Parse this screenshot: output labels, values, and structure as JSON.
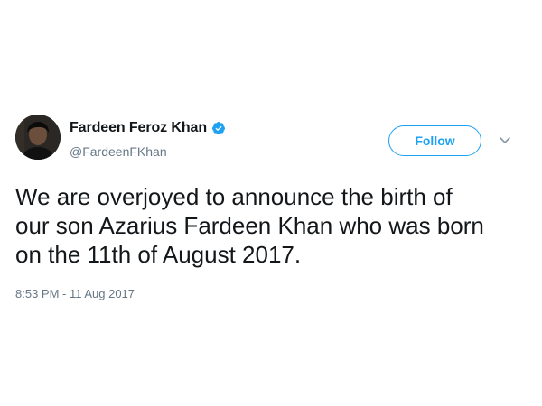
{
  "author": {
    "display_name": "Fardeen Feroz Khan",
    "handle": "@FardeenFKhan",
    "verified": true,
    "avatar_icon": "avatar-photo"
  },
  "actions": {
    "follow_label": "Follow",
    "menu_icon": "chevron-down-icon"
  },
  "tweet": {
    "lines": [
      "We are overjoyed to announce the birth of",
      "our son Azarius Fardeen Khan who was born",
      "on the 11th of August 2017."
    ],
    "timestamp": "8:53 PM - 11 Aug 2017"
  },
  "colors": {
    "accent": "#1da1f2",
    "text": "#14171a",
    "muted": "#657786"
  }
}
